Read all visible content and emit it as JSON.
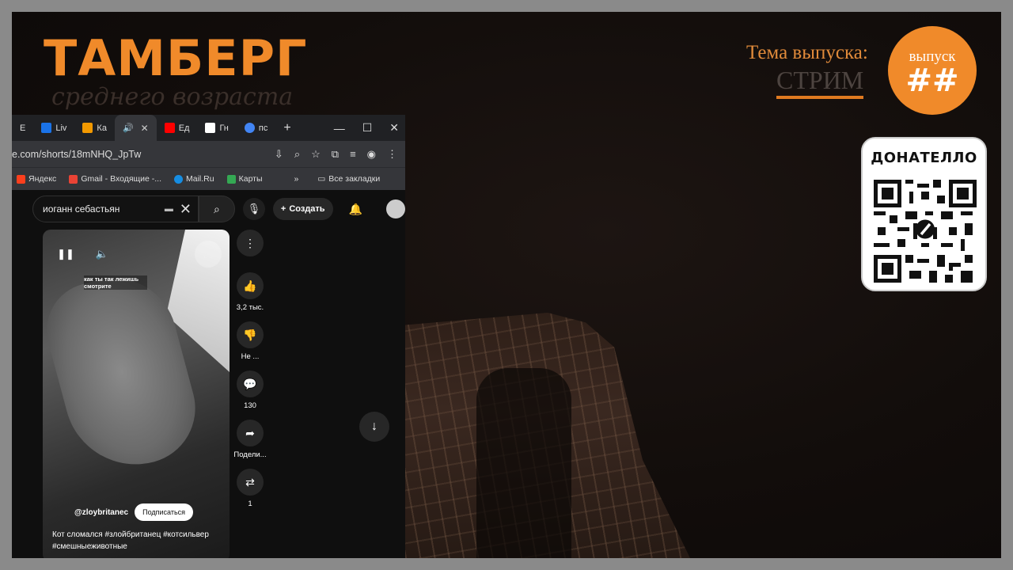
{
  "brand": {
    "title": "ТАМБЕРГ",
    "subtitle": "среднего возраста"
  },
  "issue": {
    "label": "Тема выпуска:",
    "topic": "СТРИМ",
    "badge_line1": "выпуск",
    "badge_line2": "##"
  },
  "donate": {
    "label": "ДОНАТЕЛЛО"
  },
  "colors": {
    "accent": "#f08a2a",
    "yt_bg": "#0f0f0f",
    "chrome_bg": "#35363a"
  },
  "browser": {
    "tabs": [
      {
        "label": "E",
        "icon": "tab-favicon"
      },
      {
        "label": "Liv",
        "icon": "heart-icon"
      },
      {
        "label": "Ка",
        "icon": "fl-icon"
      },
      {
        "label": "",
        "icon": "speaker-icon",
        "active": true
      },
      {
        "label": "Ед",
        "icon": "youtube-icon"
      },
      {
        "label": "Гн",
        "icon": "wikipedia-icon"
      },
      {
        "label": "пс",
        "icon": "google-icon"
      }
    ],
    "new_tab": "+",
    "url": "e.com/shorts/18mNHQ_JpTw",
    "bookmarks": [
      {
        "label": "Яндекс",
        "color": "#fc3f1d"
      },
      {
        "label": "Gmail - Входящие -...",
        "color": "#ea4335"
      },
      {
        "label": "Mail.Ru",
        "color": "#168de2"
      },
      {
        "label": "Карты",
        "color": "#34a853"
      }
    ],
    "bookmarks_more": "»",
    "all_bookmarks": "Все закладки"
  },
  "youtube": {
    "search_value": "иоганн себастьян",
    "create_label": "Создать",
    "video_caption": "как ты так лежишь смотрите",
    "channel": "@zloybritanec",
    "subscribe_label": "Подписаться",
    "description": "Кот сломался #злойбританец #котсильвер #смешныеживотные",
    "likes": "3,2 тыс.",
    "dislike_label": "Не ...",
    "comments": "130",
    "share_label": "Подели...",
    "remix_count": "1"
  }
}
